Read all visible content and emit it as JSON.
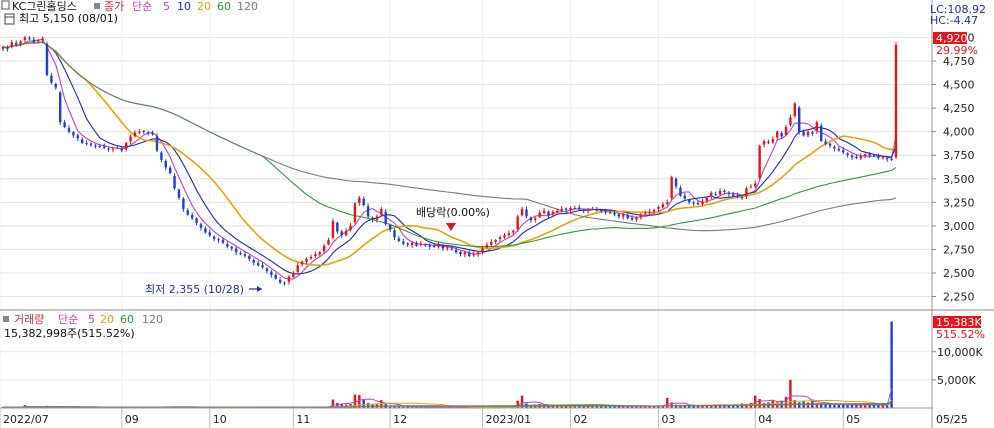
{
  "header": {
    "title": "KC그린홀딩스",
    "price_label": "종가",
    "ma_label": "단순",
    "ma_periods": [
      "5",
      "10",
      "20",
      "60",
      "120"
    ],
    "high_label": "최고 5,150 (08/01)",
    "low_label": "최저 2,355 (10/28)",
    "dividend_label": "배당락(0.00%)",
    "lc_label": "LC:108.92",
    "hc_label": "HC:-4.47"
  },
  "volume_header": {
    "title": "거래량",
    "ma_label": "단순",
    "ma_periods": [
      "5",
      "20",
      "60",
      "120"
    ],
    "last_volume": "15,382,998주(515.52%)"
  },
  "badges": {
    "price": "4,920",
    "price_change": "29.99%",
    "volume": "15,383K",
    "volume_change": "515.52%"
  },
  "colors": {
    "up": "#e8141b",
    "down": "#1f3fd6",
    "ma5": "#c042c8",
    "ma10": "#1e2fa0",
    "ma20": "#e8a30c",
    "ma60": "#2f9a3a",
    "ma120": "#7a7a7a",
    "badge": "#e8141b"
  },
  "chart_data": [
    {
      "type": "candlestick",
      "series": [
        {
          "name": "price",
          "dates": [
            "2022-07-25",
            "2022-07-26",
            "2022-07-27",
            "2022-07-28",
            "2022-07-29",
            "2022-08-01",
            "2022-08-02",
            "2022-08-03",
            "2022-08-04",
            "2022-08-05",
            "2022-08-08",
            "2022-08-09",
            "2022-08-10",
            "2022-08-11",
            "2022-08-12",
            "2022-08-16",
            "2022-08-17",
            "2022-08-18",
            "2022-08-19",
            "2022-08-22",
            "2022-08-23",
            "2022-08-24",
            "2022-08-25",
            "2022-08-26",
            "2022-08-29",
            "2022-08-30",
            "2022-08-31",
            "2022-09-01",
            "2022-09-02",
            "2022-09-05",
            "2022-09-06",
            "2022-09-07",
            "2022-09-08",
            "2022-09-13",
            "2022-09-14",
            "2022-09-15",
            "2022-09-16",
            "2022-09-19",
            "2022-09-20",
            "2022-09-21",
            "2022-09-22",
            "2022-09-23",
            "2022-09-26",
            "2022-09-27",
            "2022-09-28",
            "2022-09-29",
            "2022-09-30",
            "2022-10-04",
            "2022-10-05",
            "2022-10-06",
            "2022-10-07",
            "2022-10-11",
            "2022-10-12",
            "2022-10-13",
            "2022-10-14",
            "2022-10-17",
            "2022-10-18",
            "2022-10-19",
            "2022-10-20",
            "2022-10-21",
            "2022-10-24",
            "2022-10-25",
            "2022-10-26",
            "2022-10-27",
            "2022-10-28",
            "2022-10-31",
            "2022-11-01",
            "2022-11-02",
            "2022-11-03",
            "2022-11-04",
            "2022-11-07",
            "2022-11-08",
            "2022-11-09",
            "2022-11-10",
            "2022-11-11",
            "2022-11-14",
            "2022-11-15",
            "2022-11-16",
            "2022-11-17",
            "2022-11-18",
            "2022-11-21",
            "2022-11-22",
            "2022-11-23",
            "2022-11-24",
            "2022-11-25",
            "2022-11-28",
            "2022-11-29",
            "2022-11-30",
            "2022-12-01",
            "2022-12-02",
            "2022-12-05",
            "2022-12-06",
            "2022-12-07",
            "2022-12-08",
            "2022-12-09",
            "2022-12-12",
            "2022-12-13",
            "2022-12-14",
            "2022-12-15",
            "2022-12-16",
            "2022-12-19",
            "2022-12-20",
            "2022-12-21",
            "2022-12-22",
            "2022-12-23",
            "2022-12-26",
            "2022-12-27",
            "2022-12-28",
            "2022-12-29",
            "2023-01-02",
            "2023-01-03",
            "2023-01-04",
            "2023-01-05",
            "2023-01-06",
            "2023-01-09",
            "2023-01-10",
            "2023-01-11",
            "2023-01-12",
            "2023-01-13",
            "2023-01-16",
            "2023-01-17",
            "2023-01-18",
            "2023-01-19",
            "2023-01-20",
            "2023-01-25",
            "2023-01-26",
            "2023-01-27",
            "2023-01-30",
            "2023-01-31",
            "2023-02-01",
            "2023-02-02",
            "2023-02-03",
            "2023-02-06",
            "2023-02-07",
            "2023-02-08",
            "2023-02-09",
            "2023-02-10",
            "2023-02-13",
            "2023-02-14",
            "2023-02-15",
            "2023-02-16",
            "2023-02-17",
            "2023-02-20",
            "2023-02-21",
            "2023-02-22",
            "2023-02-23",
            "2023-02-24",
            "2023-02-27",
            "2023-02-28",
            "2023-03-02",
            "2023-03-03",
            "2023-03-06",
            "2023-03-07",
            "2023-03-08",
            "2023-03-09",
            "2023-03-10",
            "2023-03-13",
            "2023-03-14",
            "2023-03-15",
            "2023-03-16",
            "2023-03-17",
            "2023-03-20",
            "2023-03-21",
            "2023-03-22",
            "2023-03-23",
            "2023-03-24",
            "2023-03-27",
            "2023-03-28",
            "2023-03-29",
            "2023-03-30",
            "2023-03-31",
            "2023-04-03",
            "2023-04-04",
            "2023-04-05",
            "2023-04-06",
            "2023-04-07",
            "2023-04-10",
            "2023-04-11",
            "2023-04-12",
            "2023-04-13",
            "2023-04-14",
            "2023-04-17",
            "2023-04-18",
            "2023-04-19",
            "2023-04-20",
            "2023-04-21",
            "2023-04-24",
            "2023-04-25",
            "2023-04-26",
            "2023-04-27",
            "2023-04-28",
            "2023-05-02",
            "2023-05-03",
            "2023-05-04",
            "2023-05-08",
            "2023-05-09",
            "2023-05-10",
            "2023-05-11",
            "2023-05-12",
            "2023-05-15",
            "2023-05-16",
            "2023-05-17",
            "2023-05-18",
            "2023-05-19",
            "2023-05-22",
            "2023-05-23",
            "2023-05-24",
            "2023-05-25"
          ],
          "close": [
            4900,
            4880,
            4950,
            4920,
            4960,
            5000,
            4980,
            4950,
            4970,
            4990,
            4600,
            4520,
            4470,
            4100,
            4050,
            4000,
            3960,
            3930,
            3880,
            3870,
            3860,
            3850,
            3840,
            3830,
            3810,
            3820,
            3830,
            3800,
            3880,
            3950,
            3990,
            4000,
            4000,
            3990,
            3970,
            3800,
            3700,
            3620,
            3560,
            3400,
            3300,
            3180,
            3120,
            3080,
            3030,
            2980,
            2930,
            2900,
            2860,
            2850,
            2820,
            2780,
            2760,
            2720,
            2700,
            2680,
            2650,
            2610,
            2580,
            2560,
            2520,
            2480,
            2440,
            2400,
            2390,
            2460,
            2500,
            2580,
            2620,
            2650,
            2670,
            2700,
            2720,
            2790,
            2850,
            3050,
            2940,
            2900,
            2950,
            3000,
            3240,
            3300,
            3220,
            3100,
            3060,
            3100,
            3180,
            3020,
            2960,
            2880,
            2840,
            2810,
            2800,
            2820,
            2790,
            2810,
            2800,
            2780,
            2780,
            2800,
            2760,
            2770,
            2750,
            2720,
            2700,
            2720,
            2680,
            2700,
            2720,
            2760,
            2800,
            2830,
            2850,
            2880,
            2900,
            2920,
            2950,
            3100,
            3180,
            3100,
            3060,
            3080,
            3140,
            3160,
            3110,
            3150,
            3160,
            3180,
            3170,
            3190,
            3190,
            3180,
            3160,
            3170,
            3180,
            3170,
            3160,
            3150,
            3140,
            3120,
            3100,
            3120,
            3080,
            3070,
            3090,
            3120,
            3140,
            3150,
            3170,
            3200,
            3230,
            3250,
            3520,
            3420,
            3320,
            3290,
            3250,
            3240,
            3230,
            3260,
            3300,
            3350,
            3330,
            3370,
            3360,
            3340,
            3320,
            3310,
            3300,
            3400,
            3420,
            3450,
            3850,
            3900,
            3880,
            3920,
            4000,
            3950,
            4050,
            4150,
            4300,
            4000,
            3960,
            4000,
            3980,
            4100,
            3900,
            3870,
            3850,
            3820,
            3800,
            3780,
            3750,
            3730,
            3720,
            3740,
            3760,
            3750,
            3740,
            3720,
            3730,
            3710,
            3700,
            4920
          ],
          "ylim": [
            2150,
            5100
          ],
          "yticks": [
            2250,
            2500,
            2750,
            3000,
            3250,
            3500,
            3750,
            4000,
            4250,
            4500,
            4750,
            5000
          ],
          "ma_windows": [
            5,
            10,
            20,
            60,
            120
          ]
        }
      ],
      "x_tick_labels": [
        "2022/07",
        "09",
        "10",
        "11",
        "12",
        "2023/01",
        "02",
        "03",
        "04",
        "05",
        "05/25"
      ]
    },
    {
      "type": "bar",
      "series": [
        {
          "name": "거래량",
          "values": [
            180,
            140,
            160,
            150,
            170,
            520,
            200,
            160,
            150,
            140,
            380,
            300,
            260,
            220,
            180,
            150,
            130,
            120,
            110,
            100,
            100,
            100,
            95,
            90,
            90,
            95,
            90,
            90,
            110,
            140,
            160,
            150,
            140,
            130,
            120,
            260,
            230,
            200,
            190,
            240,
            250,
            220,
            200,
            180,
            170,
            160,
            150,
            140,
            130,
            130,
            120,
            120,
            110,
            110,
            100,
            100,
            100,
            95,
            90,
            90,
            95,
            100,
            140,
            180,
            220,
            160,
            150,
            160,
            170,
            180,
            160,
            150,
            160,
            200,
            260,
            1500,
            900,
            700,
            600,
            700,
            2400,
            2300,
            1600,
            900,
            600,
            800,
            1400,
            700,
            400,
            300,
            250,
            220,
            200,
            200,
            190,
            180,
            180,
            170,
            170,
            160,
            160,
            160,
            150,
            150,
            150,
            150,
            140,
            150,
            150,
            200,
            250,
            260,
            240,
            260,
            300,
            280,
            320,
            1300,
            2200,
            800,
            500,
            600,
            700,
            600,
            400,
            500,
            500,
            500,
            450,
            450,
            420,
            400,
            380,
            380,
            380,
            360,
            350,
            340,
            330,
            320,
            310,
            330,
            320,
            310,
            320,
            330,
            340,
            350,
            360,
            380,
            400,
            1800,
            1000,
            600,
            500,
            450,
            420,
            400,
            450,
            500,
            600,
            550,
            600,
            550,
            500,
            480,
            460,
            450,
            800,
            700,
            900,
            2200,
            1600,
            900,
            1000,
            1300,
            1000,
            1300,
            2000,
            5000,
            1400,
            1000,
            1200,
            1000,
            1500,
            800,
            700,
            650,
            600,
            580,
            560,
            540,
            520,
            500,
            520,
            560,
            540,
            520,
            500,
            510,
            490,
            480,
            15383
          ],
          "ylim": [
            0,
            16000
          ],
          "yticks": [
            5000,
            10000
          ],
          "ytick_labels": [
            "5,000K",
            "10,000K"
          ],
          "unit": "K"
        }
      ]
    }
  ]
}
